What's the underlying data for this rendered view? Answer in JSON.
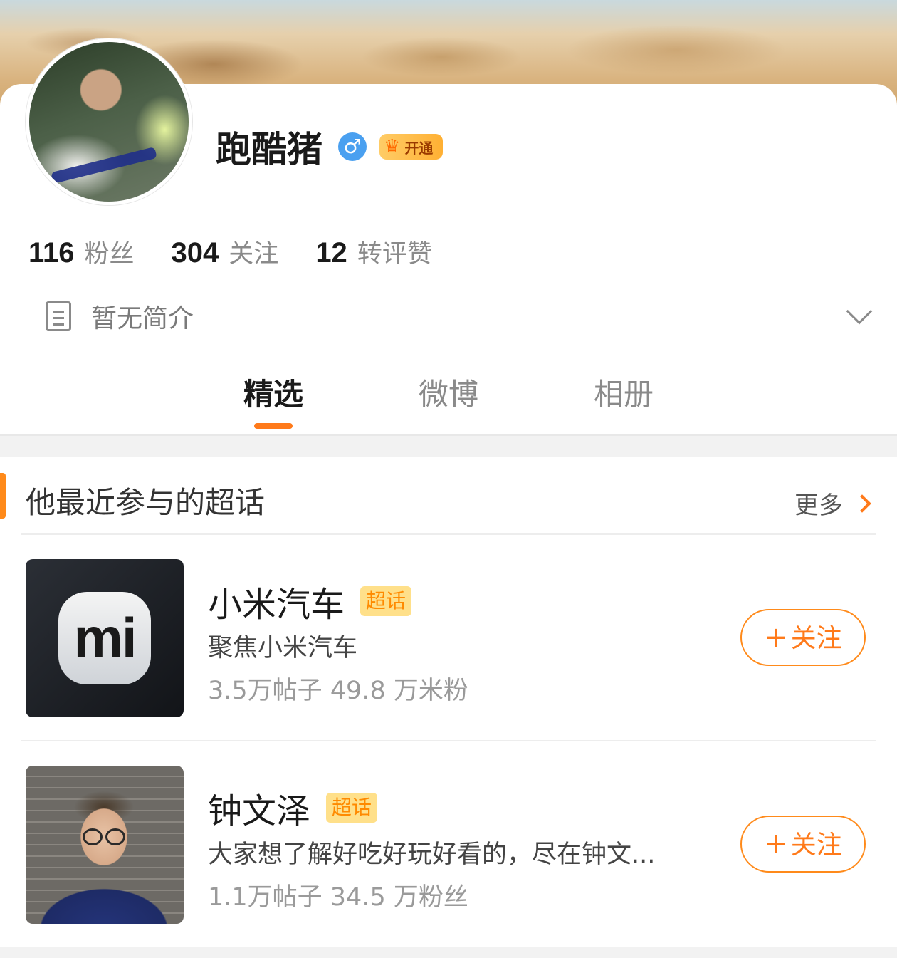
{
  "profile": {
    "name": "跑酷猪",
    "gender_symbol": "♂",
    "vip_label": "开通",
    "stats": [
      {
        "num": "116",
        "label": "粉丝"
      },
      {
        "num": "304",
        "label": "关注"
      },
      {
        "num": "12",
        "label": "转评赞"
      }
    ],
    "bio": "暂无简介"
  },
  "tabs": [
    {
      "label": "精选",
      "active": true
    },
    {
      "label": "微博",
      "active": false
    },
    {
      "label": "相册",
      "active": false
    }
  ],
  "supertopics": {
    "title": "他最近参与的超话",
    "more_label": "更多",
    "items": [
      {
        "title": "小米汽车",
        "tag": "超话",
        "logo_text": "mi",
        "desc": "聚焦小米汽车",
        "meta": "3.5万帖子 49.8 万米粉",
        "button": "关注",
        "button_plus": "+"
      },
      {
        "title": "钟文泽",
        "tag": "超话",
        "desc": "大家想了解好吃好玩好看的，尽在钟文...",
        "meta": "1.1万帖子 34.5 万粉丝",
        "button": "关注",
        "button_plus": "+"
      }
    ]
  },
  "colors": {
    "accent": "#ff7a1a",
    "tag_bg": "#ffe08a",
    "gender_blue": "#4aa0f0"
  }
}
